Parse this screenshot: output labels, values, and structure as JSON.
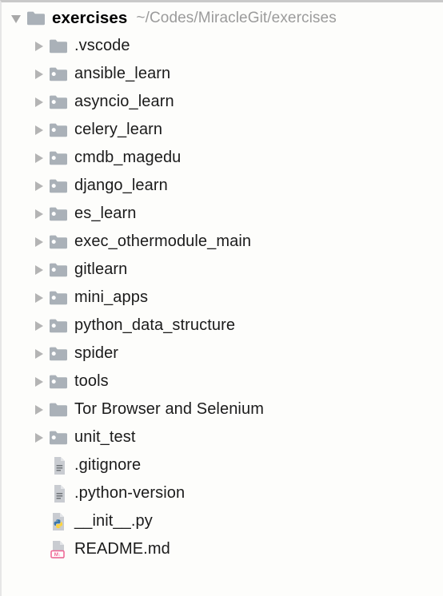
{
  "panel": {
    "name": "project-tree-panel",
    "background_color": "#fdfdfb",
    "border_color": "#c9c9c9"
  },
  "colors": {
    "folder": "#aab1b8",
    "folder_module_dot": "#ffffff",
    "file_page": "#c9ccd1",
    "file_page_fold": "#e3e5e8",
    "markdown_badge": "#f06292",
    "python_blue": "#3c78aa",
    "python_yellow": "#ffd43b",
    "text": "#1b1b1b",
    "path_text": "#9b9b9b",
    "twisty": "#b4b4b4"
  },
  "root": {
    "name": "exercises",
    "path": "~/Codes/MiracleGit/exercises",
    "icon": "folder-icon",
    "expanded": true,
    "twisty": "expanded"
  },
  "children": [
    {
      "name": ".vscode",
      "type": "folder",
      "icon": "folder-icon",
      "twisty": "collapsed"
    },
    {
      "name": "ansible_learn",
      "type": "folder-module",
      "icon": "folder-module-icon",
      "twisty": "collapsed"
    },
    {
      "name": "asyncio_learn",
      "type": "folder-module",
      "icon": "folder-module-icon",
      "twisty": "collapsed"
    },
    {
      "name": "celery_learn",
      "type": "folder-module",
      "icon": "folder-module-icon",
      "twisty": "collapsed"
    },
    {
      "name": "cmdb_magedu",
      "type": "folder-module",
      "icon": "folder-module-icon",
      "twisty": "collapsed"
    },
    {
      "name": "django_learn",
      "type": "folder-module",
      "icon": "folder-module-icon",
      "twisty": "collapsed"
    },
    {
      "name": "es_learn",
      "type": "folder-module",
      "icon": "folder-module-icon",
      "twisty": "collapsed"
    },
    {
      "name": "exec_othermodule_main",
      "type": "folder-module",
      "icon": "folder-module-icon",
      "twisty": "collapsed"
    },
    {
      "name": "gitlearn",
      "type": "folder-module",
      "icon": "folder-module-icon",
      "twisty": "collapsed"
    },
    {
      "name": "mini_apps",
      "type": "folder-module",
      "icon": "folder-module-icon",
      "twisty": "collapsed"
    },
    {
      "name": "python_data_structure",
      "type": "folder-module",
      "icon": "folder-module-icon",
      "twisty": "collapsed"
    },
    {
      "name": "spider",
      "type": "folder-module",
      "icon": "folder-module-icon",
      "twisty": "collapsed"
    },
    {
      "name": "tools",
      "type": "folder-module",
      "icon": "folder-module-icon",
      "twisty": "collapsed"
    },
    {
      "name": "Tor Browser and Selenium",
      "type": "folder",
      "icon": "folder-icon",
      "twisty": "collapsed"
    },
    {
      "name": "unit_test",
      "type": "folder-module",
      "icon": "folder-module-icon",
      "twisty": "collapsed"
    },
    {
      "name": ".gitignore",
      "type": "file-text",
      "icon": "text-file-icon",
      "twisty": "none"
    },
    {
      "name": ".python-version",
      "type": "file-text",
      "icon": "text-file-icon",
      "twisty": "none"
    },
    {
      "name": "__init__.py",
      "type": "file-python",
      "icon": "python-file-icon",
      "twisty": "none"
    },
    {
      "name": "README.md",
      "type": "file-markdown",
      "icon": "markdown-file-icon",
      "twisty": "none"
    }
  ]
}
